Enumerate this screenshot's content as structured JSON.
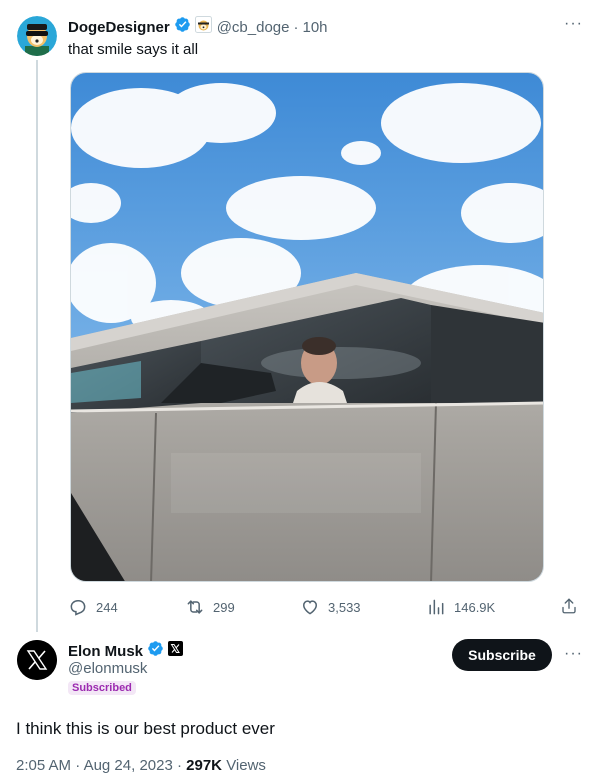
{
  "quoted_tweet": {
    "author_name": "DogeDesigner",
    "handle": "@cb_doge",
    "separator": "·",
    "time": "10h",
    "text": "that smile says it all",
    "more_label": "···",
    "actions": {
      "replies": "244",
      "reposts": "299",
      "likes": "3,533",
      "views": "146.9K"
    }
  },
  "main_tweet": {
    "author_name": "Elon Musk",
    "handle": "@elonmusk",
    "subscribed_label": "Subscribed",
    "subscribe_button": "Subscribe",
    "more_label": "···",
    "text": "I think this is our best product ever",
    "time": "2:05 AM",
    "date": "Aug 24, 2023",
    "separator": "·",
    "views_count": "297K",
    "views_label": "Views"
  },
  "colors": {
    "verified_blue": "#1d9bf0",
    "muted": "#536471",
    "subscribe_bg": "#0f1419",
    "subscribed_pill": "#9c2bb0"
  },
  "icons": [
    "avatar-doge",
    "verified-badge-icon",
    "doge-affiliate-icon",
    "more-icon",
    "reply-icon",
    "repost-icon",
    "like-icon",
    "views-icon",
    "share-icon",
    "x-logo-icon"
  ]
}
